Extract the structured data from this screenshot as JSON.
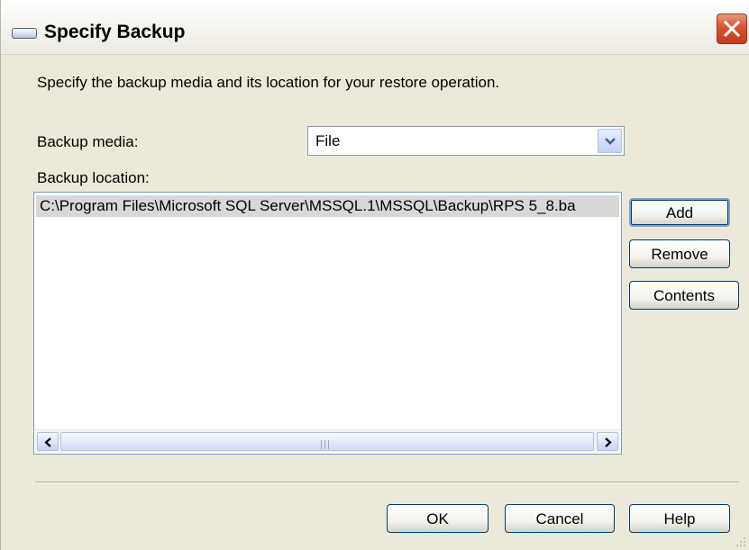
{
  "window": {
    "title": "Specify Backup"
  },
  "description": "Specify the backup media and its location for your restore operation.",
  "backup_media": {
    "label": "Backup media:",
    "selected": "File"
  },
  "backup_location": {
    "label": "Backup location:",
    "items": [
      "C:\\Program Files\\Microsoft SQL Server\\MSSQL.1\\MSSQL\\Backup\\RPS 5_8.ba"
    ]
  },
  "side_buttons": {
    "add": "Add",
    "remove": "Remove",
    "contents": "Contents"
  },
  "footer_buttons": {
    "ok": "OK",
    "cancel": "Cancel",
    "help": "Help"
  },
  "icons": {
    "title": "window-icon",
    "close": "close-icon",
    "dropdown": "chevron-down-icon",
    "scroll_left": "arrow-left-icon",
    "scroll_right": "arrow-right-icon"
  },
  "colors": {
    "dialog_bg": "#ece9d8",
    "close_button": "#d8532c",
    "selected_row": "#d8d8d8",
    "button_border": "#003c74"
  }
}
